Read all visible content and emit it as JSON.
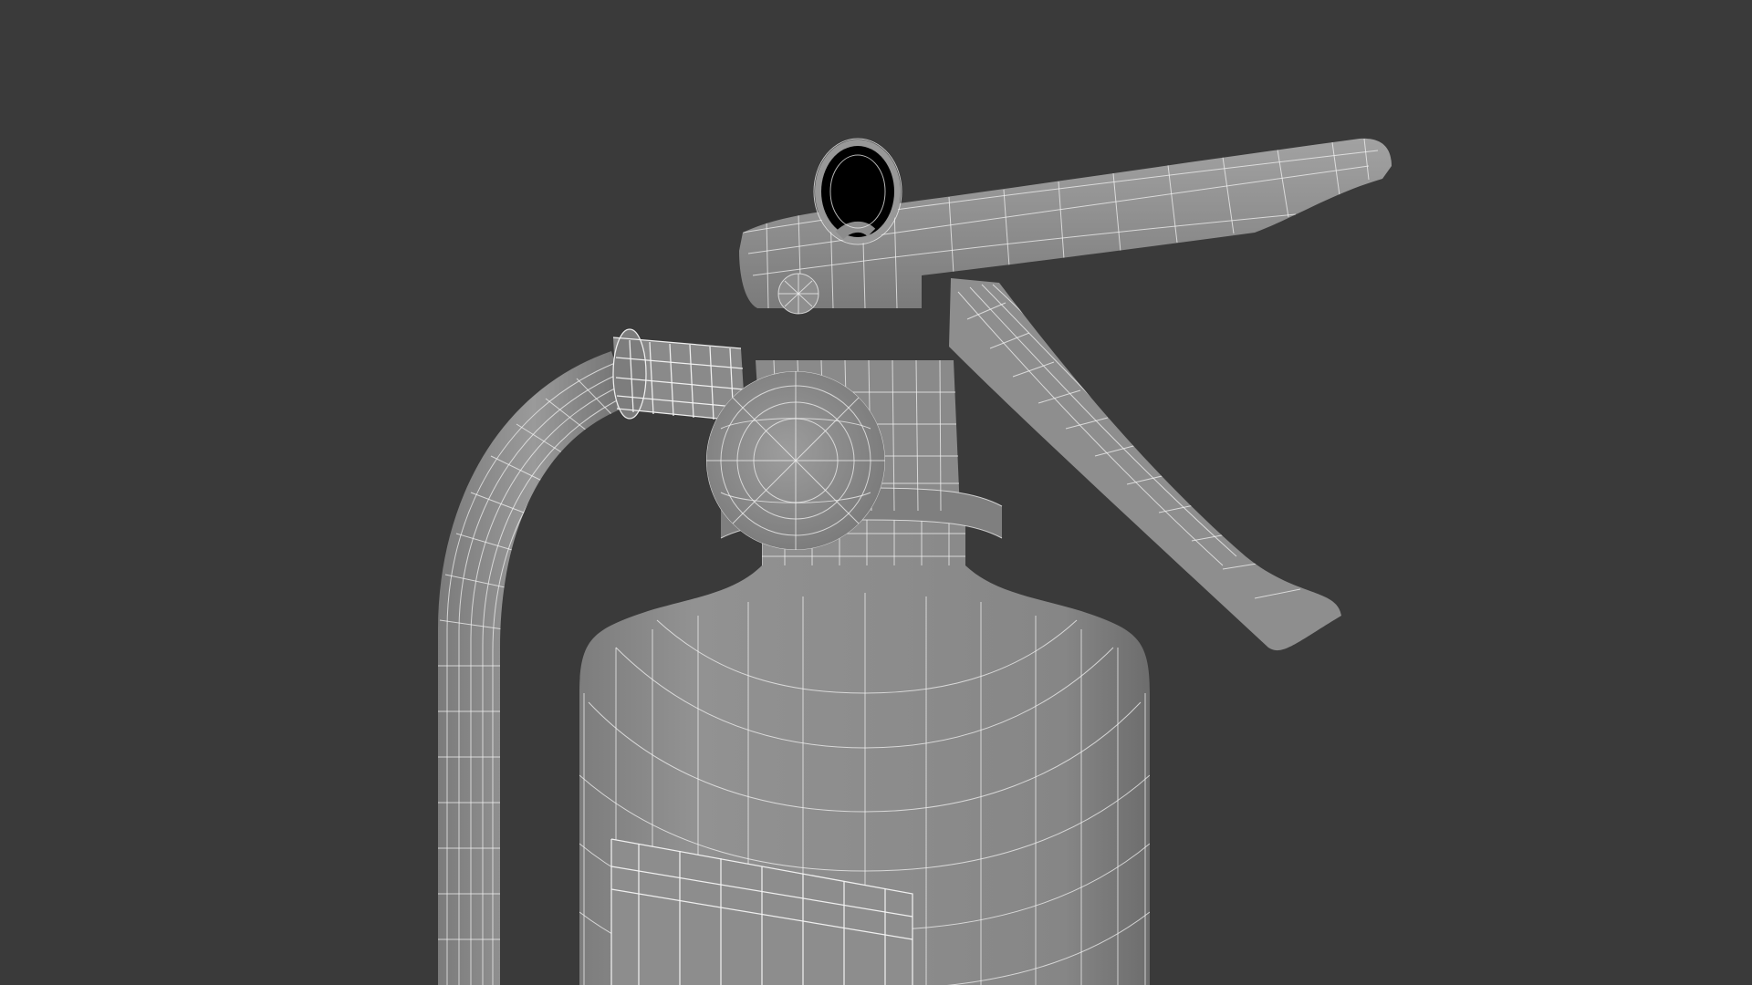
{
  "scene": {
    "colors": {
      "background": "#3a3a3a",
      "model_fill": "#8f8f8f",
      "model_dark": "#6f6f6f",
      "model_light": "#a5a5a5",
      "wire": "#f4f4f4"
    },
    "objects": [
      "fire-extinguisher-body",
      "neck",
      "pressure-gauge",
      "hose",
      "hose-coupling",
      "handle",
      "lever",
      "pull-pin-ring",
      "label-panel"
    ]
  }
}
